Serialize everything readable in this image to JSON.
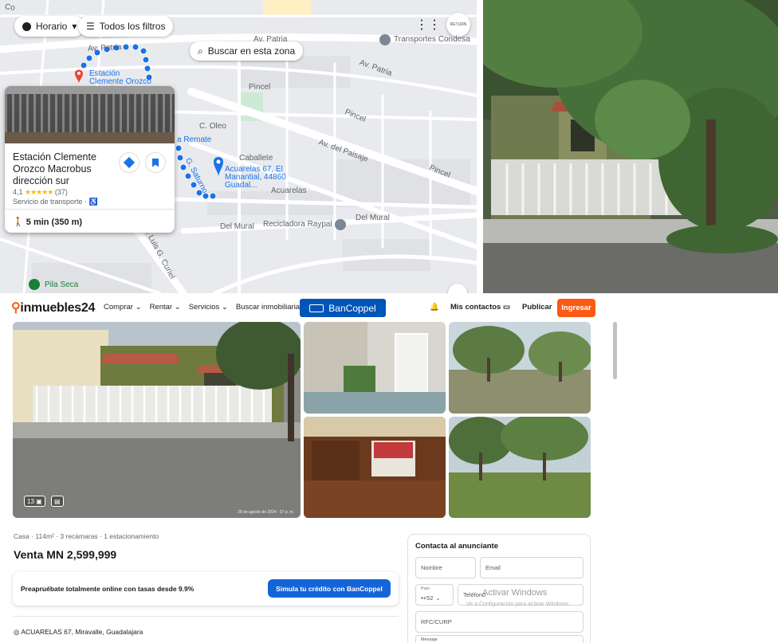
{
  "map": {
    "filters": {
      "horario": "Horario",
      "todos": "Todos los filtros"
    },
    "search_zone": "Buscar en esta zona",
    "apps_icon": "grid-icon",
    "top_right_thumb": "RETURN",
    "streets": {
      "patria_top": "Av. Patria",
      "patria_right": "Av. Patria",
      "pincel_1": "Pincel",
      "pincel_2": "Pincel",
      "pincel_3": "Pincel",
      "oleo": "C. Oleo",
      "remate": "a Remate",
      "caballete": "Caballete",
      "paisaje": "Av. del Paisaje",
      "acuarelas": "Acuarelas",
      "mural_1": "Del Mural",
      "mural_2": "Del Mural",
      "curiel": "Av. Luis G. Curiel",
      "saturno": "G. Saturno",
      "corner": "Co"
    },
    "pois": {
      "transportes": "Transportes Condesa",
      "destination": "Acuarelas 67, El Manantial, 44860 Guadal...",
      "reciclador": "Recicladora Raypal",
      "pila_seca": "Pila Seca",
      "station_pin": "Estación Clemente Orozco Macrobus"
    },
    "place_card": {
      "title": "Estación Clemente Orozco Macrobus dirección sur",
      "rating": "4,1",
      "stars": "★★★★★",
      "reviews": "(37)",
      "category": "Servicio de transporte ·",
      "walk": "5 min (350 m)"
    }
  },
  "listing": {
    "logo": "inmuebles24",
    "nav": [
      "Comprar ⌄",
      "Rentar ⌄",
      "Servicios ⌄",
      "Buscar inmobiliarias"
    ],
    "bancoppel": "BanCoppel",
    "my_contacts": "Mis contactos",
    "publish": "Publicar",
    "login": "Ingresar",
    "photo_count": "13",
    "photo_date": "28 de agosto de 2024 · 07 p. m.",
    "features": "Casa · 114m² · 3 recámaras · 1 estacionamiento",
    "price": "Venta MN 2,599,999",
    "promo_text": "Preapruébate totalmente online con tasas desde 9.9%",
    "promo_button": "Simula tu crédito con BanCoppel",
    "address": "ACUARELAS 67, Miravalle, Guadalajara",
    "contact": {
      "title": "Contacta al anunciante",
      "name_placeholder": "Nombre",
      "email_placeholder": "Email",
      "country_label": "País",
      "country_code": "+52",
      "phone_placeholder": "Teléfono",
      "rfc_placeholder": "RFC/CURP",
      "message_label": "Mensaje"
    },
    "windows_watermark": "Activar Windows",
    "windows_watermark_sub": "Ve a Configuración para activar Windows."
  }
}
